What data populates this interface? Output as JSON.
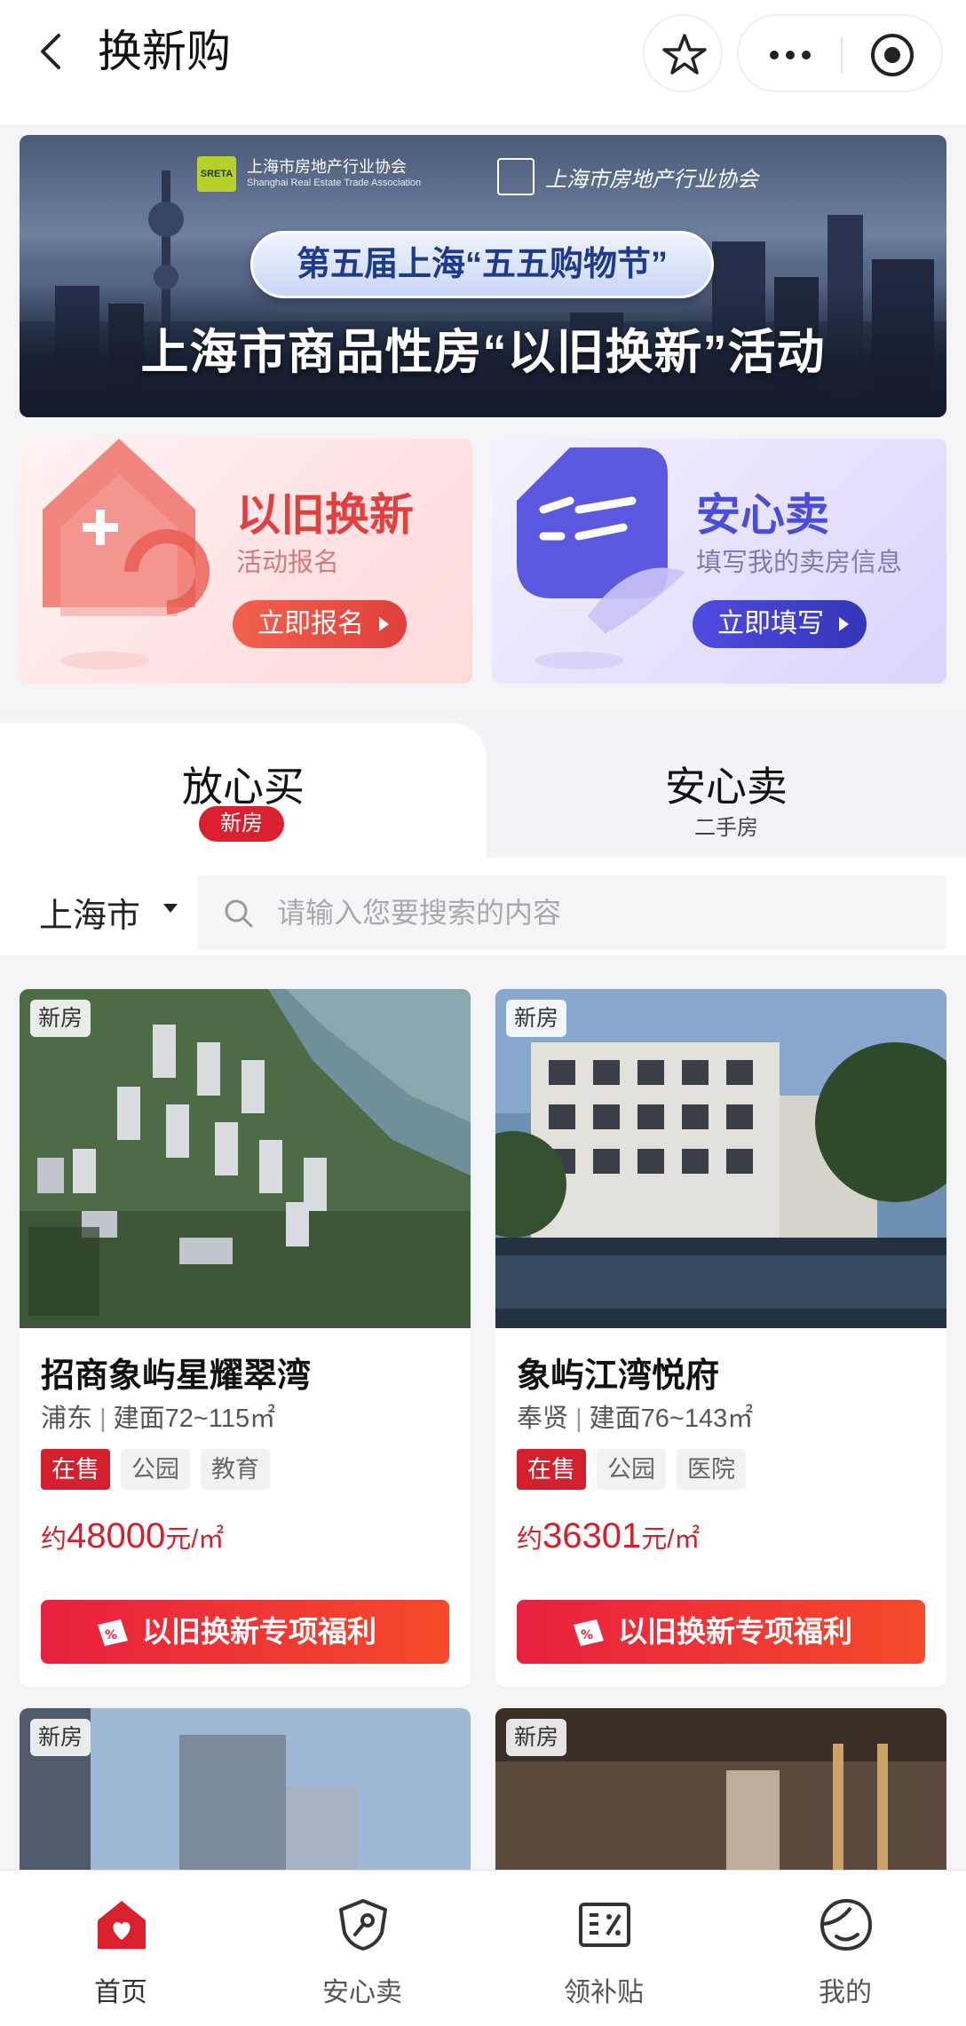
{
  "header": {
    "title": "换新购"
  },
  "banner": {
    "association_cn": "上海市房地产行业协会",
    "association_en": "Shanghai Real Estate Trade Association",
    "association_badge": "SRETA",
    "association_script": "上海市房地产行业协会",
    "event_title": "第五届上海“五五购物节”",
    "main_title": "上海市商品性房“以旧换新”活动"
  },
  "promos": [
    {
      "title": "以旧换新",
      "subtitle": "活动报名",
      "action": "立即报名",
      "accent": "#e43f3f"
    },
    {
      "title": "安心卖",
      "subtitle": "填写我的卖房信息",
      "action": "立即填写",
      "accent": "#4b4dd8"
    }
  ],
  "tabs": [
    {
      "label": "放心买",
      "sub": "新房",
      "active": true
    },
    {
      "label": "安心卖",
      "sub": "二手房",
      "active": false
    }
  ],
  "search": {
    "city": "上海市",
    "placeholder": "请输入您要搜索的内容",
    "value": ""
  },
  "listings": [
    {
      "badge": "新房",
      "name": "招商象屿星耀翠湾",
      "district": "浦东",
      "area": "建面72~115㎡",
      "tags": [
        "在售",
        "公园",
        "教育"
      ],
      "price_prefix": "约",
      "price": "48000",
      "price_unit": "元/㎡",
      "cta": "以旧换新专项福利"
    },
    {
      "badge": "新房",
      "name": "象屿江湾悦府",
      "district": "奉贤",
      "area": "建面76~143㎡",
      "tags": [
        "在售",
        "公园",
        "医院"
      ],
      "price_prefix": "约",
      "price": "36301",
      "price_unit": "元/㎡",
      "cta": "以旧换新专项福利"
    },
    {
      "badge": "新房"
    },
    {
      "badge": "新房"
    }
  ],
  "bottom_nav": [
    {
      "label": "首页",
      "icon": "home-icon",
      "active": true
    },
    {
      "label": "安心卖",
      "icon": "shield-key-icon",
      "active": false
    },
    {
      "label": "领补贴",
      "icon": "coupon-icon",
      "active": false
    },
    {
      "label": "我的",
      "icon": "profile-icon",
      "active": false
    }
  ],
  "colors": {
    "brand_red": "#d3202c",
    "cta_red": "#e8203f",
    "purple": "#4b4dd8"
  }
}
